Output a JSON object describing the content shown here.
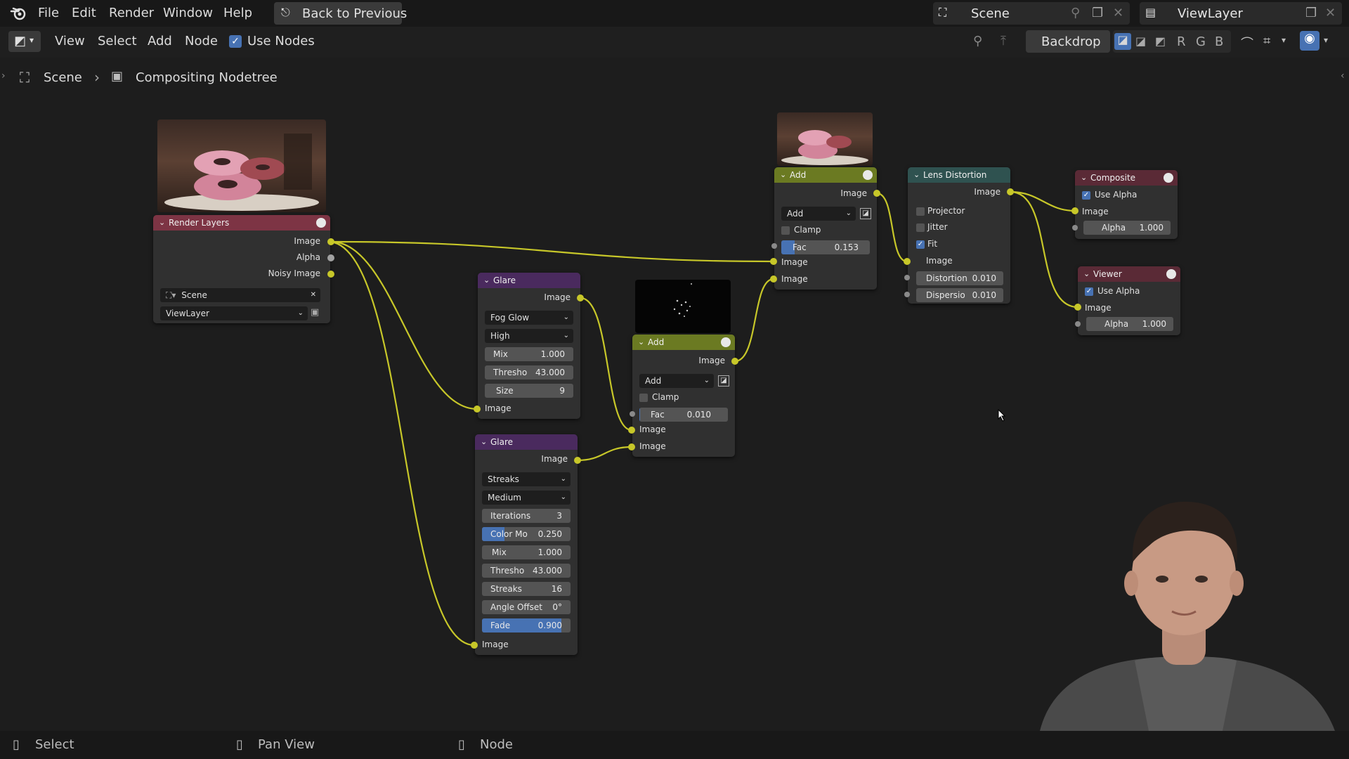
{
  "menubar": {
    "items": [
      "File",
      "Edit",
      "Render",
      "Window",
      "Help"
    ],
    "back_button": "Back to Previous",
    "scene_name": "Scene",
    "view_layer": "ViewLayer"
  },
  "toolbar": {
    "view": "View",
    "select": "Select",
    "add": "Add",
    "node": "Node",
    "use_nodes": "Use Nodes",
    "backdrop": "Backdrop",
    "channels": [
      "R",
      "G",
      "B"
    ]
  },
  "breadcrumb": {
    "scene": "Scene",
    "tree": "Compositing Nodetree"
  },
  "nodes": {
    "render_layers": {
      "title": "Render Layers",
      "outputs": [
        "Image",
        "Alpha",
        "Noisy Image"
      ],
      "scene": "Scene",
      "view_layer": "ViewLayer"
    },
    "glare1": {
      "title": "Glare",
      "output": "Image",
      "type": "Fog Glow",
      "quality": "High",
      "mix_label": "Mix",
      "mix_value": "1.000",
      "thresh_label": "Thresho",
      "thresh_value": "43.000",
      "size_label": "Size",
      "size_value": "9",
      "input": "Image"
    },
    "glare2": {
      "title": "Glare",
      "output": "Image",
      "type": "Streaks",
      "quality": "Medium",
      "iter_label": "Iterations",
      "iter_value": "3",
      "colmod_label": "Color Mo",
      "colmod_value": "0.250",
      "colmod_fill": 0.25,
      "mix_label": "Mix",
      "mix_value": "1.000",
      "thresh_label": "Thresho",
      "thresh_value": "43.000",
      "streaks_label": "Streaks",
      "streaks_value": "16",
      "angle_label": "Angle Offset",
      "angle_value": "0°",
      "fade_label": "Fade",
      "fade_value": "0.900",
      "fade_fill": 0.9,
      "input": "Image"
    },
    "add1": {
      "title": "Add",
      "output": "Image",
      "blend": "Add",
      "clamp": "Clamp",
      "fac_label": "Fac",
      "fac_value": "0.010",
      "fac_fill": 0.01,
      "in1": "Image",
      "in2": "Image"
    },
    "add2": {
      "title": "Add",
      "output": "Image",
      "blend": "Add",
      "clamp": "Clamp",
      "fac_label": "Fac",
      "fac_value": "0.153",
      "fac_fill": 0.153,
      "in1": "Image",
      "in2": "Image"
    },
    "lens": {
      "title": "Lens Distortion",
      "output": "Image",
      "projector": "Projector",
      "jitter": "Jitter",
      "fit": "Fit",
      "input": "Image",
      "dist_label": "Distortion",
      "dist_value": "0.010",
      "disp_label": "Dispersio",
      "disp_value": "0.010"
    },
    "composite": {
      "title": "Composite",
      "use_alpha": "Use Alpha",
      "input": "Image",
      "alpha_label": "Alpha",
      "alpha_value": "1.000"
    },
    "viewer": {
      "title": "Viewer",
      "use_alpha": "Use Alpha",
      "input": "Image",
      "alpha_label": "Alpha",
      "alpha_value": "1.000"
    }
  },
  "statusbar": {
    "select": "Select",
    "pan": "Pan View",
    "node": "Node"
  },
  "colors": {
    "render_header": "#7d3444",
    "glare_header": "#4a2a5e",
    "add_header": "#6b7a22",
    "lens_header": "#2f5250",
    "output_header": "#5a2a36",
    "wire": "#c7c729"
  }
}
